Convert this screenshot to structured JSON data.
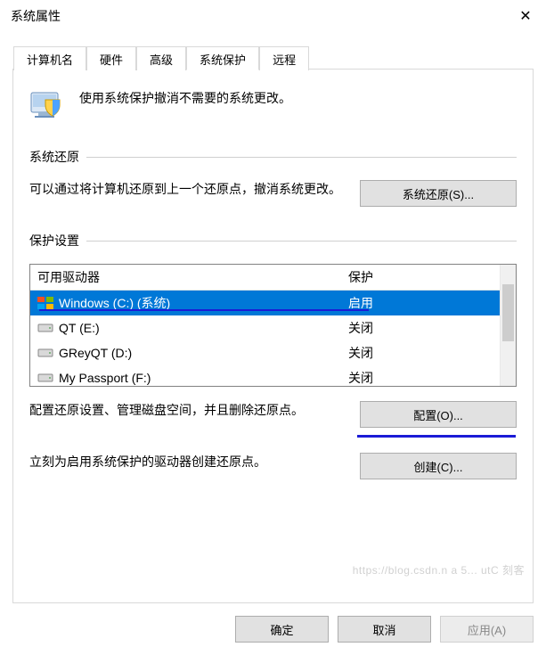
{
  "window": {
    "title": "系统属性"
  },
  "tabs": {
    "t0": "计算机名",
    "t1": "硬件",
    "t2": "高级",
    "t3": "系统保护",
    "t4": "远程"
  },
  "intro": "使用系统保护撤消不需要的系统更改。",
  "restore": {
    "heading": "系统还原",
    "desc": "可以通过将计算机还原到上一个还原点，撤消系统更改。",
    "button": "系统还原(S)..."
  },
  "settings": {
    "heading": "保护设置",
    "col_drive": "可用驱动器",
    "col_protect": "保护",
    "drives": [
      {
        "name": "Windows (C:) (系统)",
        "protect": "启用",
        "selected": true,
        "type": "os"
      },
      {
        "name": "QT (E:)",
        "protect": "关闭",
        "selected": false,
        "type": "hdd"
      },
      {
        "name": "GReyQT (D:)",
        "protect": "关闭",
        "selected": false,
        "type": "hdd"
      },
      {
        "name": "My Passport (F:)",
        "protect": "关闭",
        "selected": false,
        "type": "hdd"
      }
    ],
    "configure_desc": "配置还原设置、管理磁盘空间，并且删除还原点。",
    "configure_btn": "配置(O)...",
    "create_desc": "立刻为启用系统保护的驱动器创建还原点。",
    "create_btn": "创建(C)..."
  },
  "footer": {
    "ok": "确定",
    "cancel": "取消",
    "apply": "应用(A)"
  },
  "watermark": "https://blog.csdn.n a 5... utC 刻客"
}
